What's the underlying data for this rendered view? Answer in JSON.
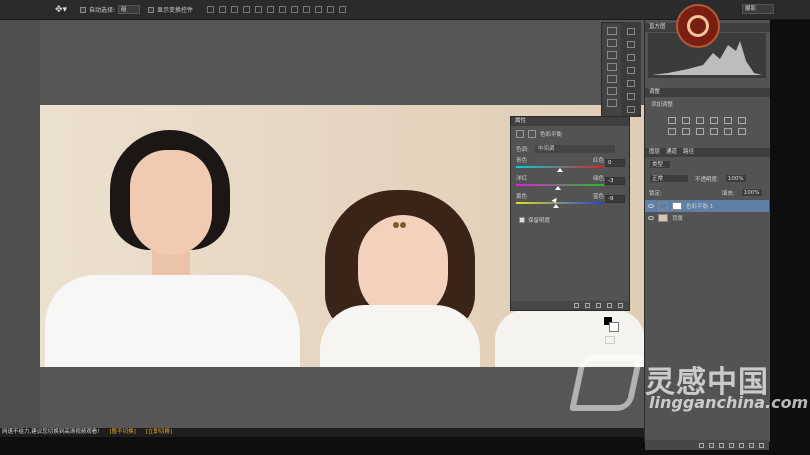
{
  "toolbar": {
    "auto_select_label": "自动选择:",
    "auto_select_value": "组",
    "show_transform_label": "显示变换控件",
    "workspace_value": "摄影"
  },
  "properties_panel": {
    "title": "属性",
    "subtitle": "色彩平衡",
    "tone_label": "色调:",
    "tone_value": "中间调",
    "sliders": [
      {
        "left": "青色",
        "right": "红色",
        "value": "0",
        "position": 0.5,
        "gradient": "linear-gradient(90deg,#00d0e0,#e02020)"
      },
      {
        "left": "洋红",
        "right": "绿色",
        "value": "-3",
        "position": 0.48,
        "gradient": "linear-gradient(90deg,#e020e0,#20c020)"
      },
      {
        "left": "黄色",
        "right": "蓝色",
        "value": "-9",
        "position": 0.45,
        "gradient": "linear-gradient(90deg,#e0e020,#2040e0)"
      }
    ],
    "preserve_luminosity": "保留明度"
  },
  "right_panels": {
    "histogram_tabs": [
      "直方图"
    ],
    "adjustments_title": "调整",
    "adjustments_subtitle": "添加调整",
    "layers_tabs": [
      "图层",
      "通道",
      "路径"
    ],
    "filter_type": "类型",
    "blend_mode": "正常",
    "opacity_label": "不透明度:",
    "opacity_value": "100%",
    "lock_label": "锁定:",
    "fill_label": "填充:",
    "fill_value": "100%",
    "layers": [
      {
        "name": "色彩平衡 1",
        "selected": true
      },
      {
        "name": "背景",
        "selected": false
      }
    ]
  },
  "status": {
    "message": "网速不给力,建议您切换到高清视频观看!",
    "link1": "[暂不切换]",
    "link2": "[立即切换]"
  },
  "watermark": {
    "cn": "灵感中国",
    "url": "lingganchina.com"
  }
}
